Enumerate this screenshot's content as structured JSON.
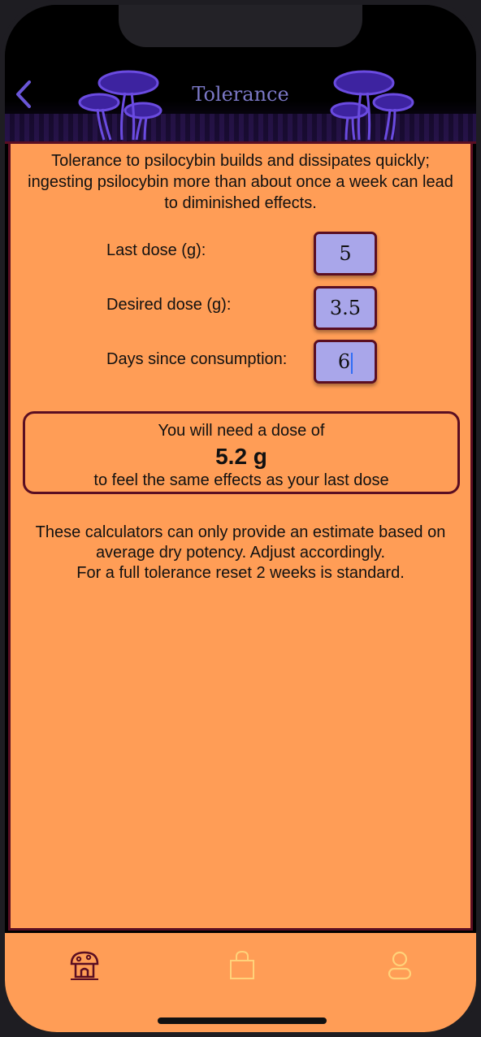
{
  "header": {
    "title": "Tolerance",
    "back_icon": "chevron-left-icon"
  },
  "intro_text": "Tolerance to psilocybin builds and dissipates quickly; ingesting psilocybin more than about once a week can lead to diminished effects.",
  "fields": {
    "last_dose": {
      "label": "Last dose (g):",
      "value": "5"
    },
    "desired_dose": {
      "label": "Desired dose (g):",
      "value": "3.5"
    },
    "days_since": {
      "label": "Days since consumption:",
      "value": "6"
    }
  },
  "result": {
    "line1": "You will need a dose of",
    "value": "5.2 g",
    "line3": "to feel the same effects as your last dose"
  },
  "note": {
    "line1": "These calculators can only provide an estimate based on average dry potency. Adjust accordingly.",
    "line2": "For a full tolerance reset 2 weeks is standard."
  },
  "tabs": [
    {
      "icon": "mushroom-house-icon",
      "active": true
    },
    {
      "icon": "shopping-bag-icon",
      "active": false
    },
    {
      "icon": "profile-icon",
      "active": false
    }
  ],
  "colors": {
    "background": "#ff9d56",
    "border": "#5a0e22",
    "field": "#a9a6ea",
    "title": "#7b78c6",
    "accent": "#6a56d8"
  }
}
